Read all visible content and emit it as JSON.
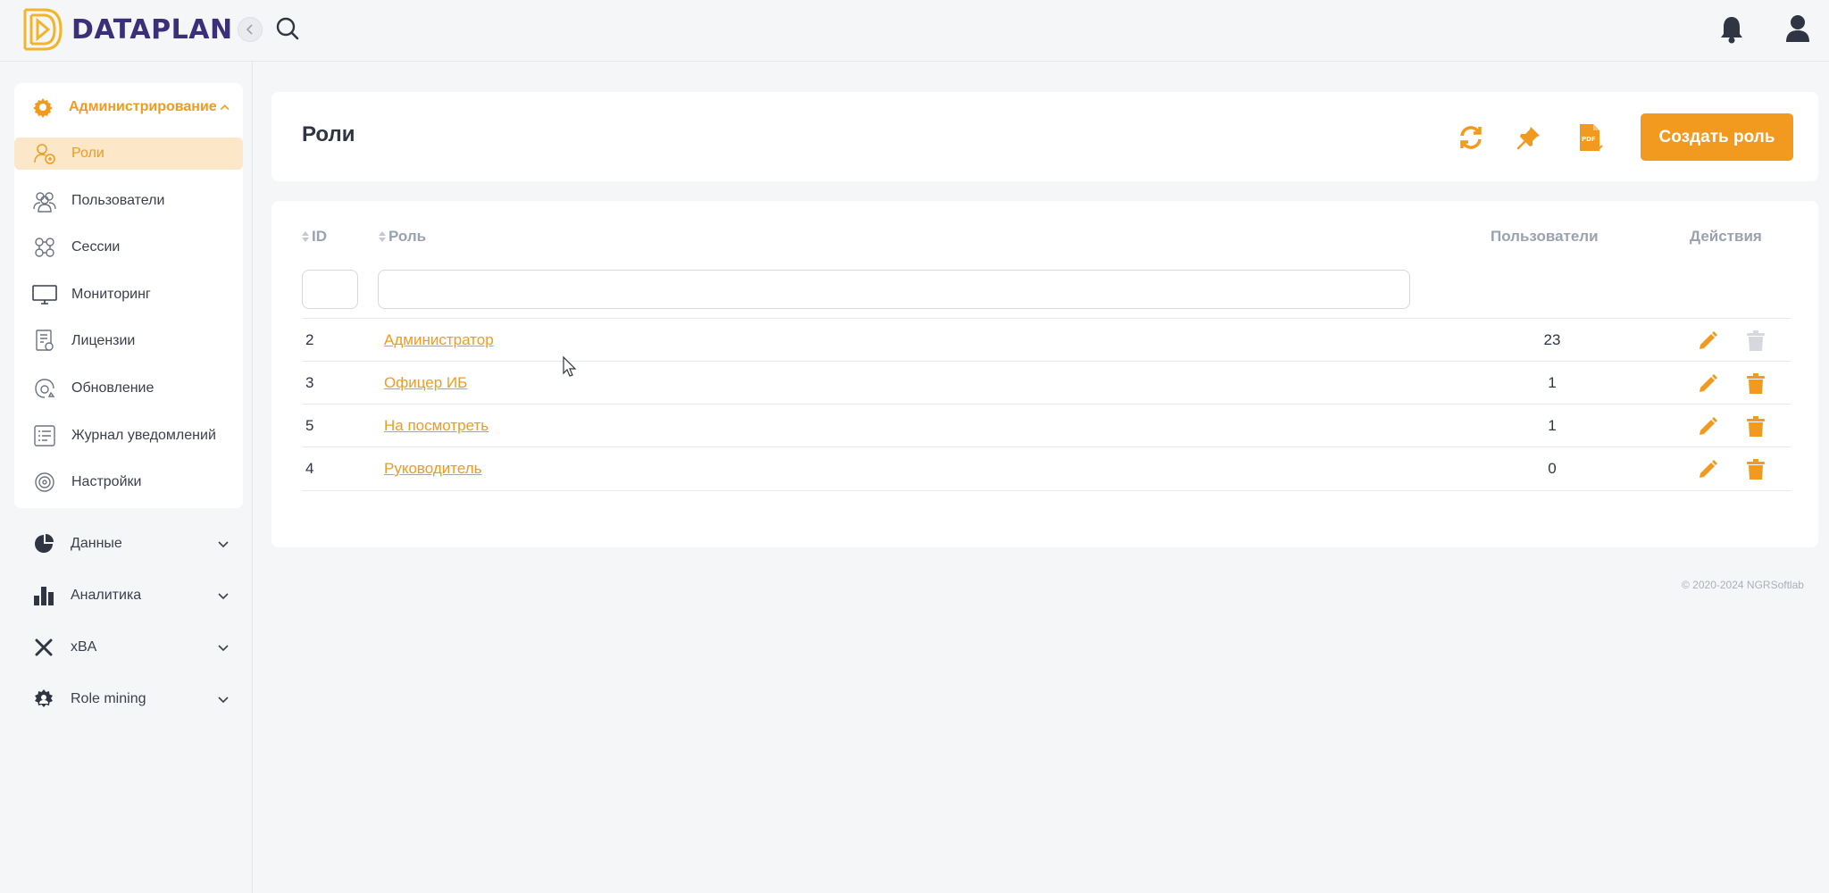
{
  "app": {
    "logo_text": "DATAPLAN",
    "accent_color": "#f29a1f",
    "brand_color": "#3b2f7a"
  },
  "topbar": {
    "icons": [
      "chevron-left-icon",
      "search-icon",
      "bell-icon",
      "user-icon"
    ]
  },
  "sidebar": {
    "admin_section": {
      "label": "Администрирование",
      "icon": "gear-icon",
      "expanded": true,
      "items": [
        {
          "label": "Роли",
          "icon": "roles-icon",
          "active": true
        },
        {
          "label": "Пользователи",
          "icon": "users-icon"
        },
        {
          "label": "Сессии",
          "icon": "sessions-icon"
        },
        {
          "label": "Мониторинг",
          "icon": "monitor-icon"
        },
        {
          "label": "Лицензии",
          "icon": "license-icon"
        },
        {
          "label": "Обновление",
          "icon": "update-icon"
        },
        {
          "label": "Журнал уведомлений",
          "icon": "journal-icon"
        },
        {
          "label": "Настройки",
          "icon": "settings-icon"
        }
      ]
    },
    "sections": [
      {
        "label": "Данные",
        "icon": "pie-chart-icon"
      },
      {
        "label": "Аналитика",
        "icon": "bar-chart-icon"
      },
      {
        "label": "xBA",
        "icon": "xba-icon"
      },
      {
        "label": "Role mining",
        "icon": "role-mining-icon"
      }
    ]
  },
  "header": {
    "title": "Роли",
    "icons": [
      "refresh-icon",
      "pin-icon",
      "pdf-export-icon"
    ],
    "create_button": "Создать роль"
  },
  "table": {
    "columns": {
      "id": "ID",
      "role": "Роль",
      "users": "Пользователи",
      "actions": "Действия"
    },
    "filters": {
      "id": "",
      "role": ""
    },
    "rows": [
      {
        "id": "2",
        "role": "Администратор",
        "users": "23",
        "delete_enabled": false
      },
      {
        "id": "3",
        "role": "Офицер ИБ",
        "users": "1",
        "delete_enabled": true
      },
      {
        "id": "5",
        "role": "На посмотреть",
        "users": "1",
        "delete_enabled": true
      },
      {
        "id": "4",
        "role": "Руководитель",
        "users": "0",
        "delete_enabled": true
      }
    ]
  },
  "footer": {
    "copyright": "© 2020-2024 NGRSoftlab"
  }
}
